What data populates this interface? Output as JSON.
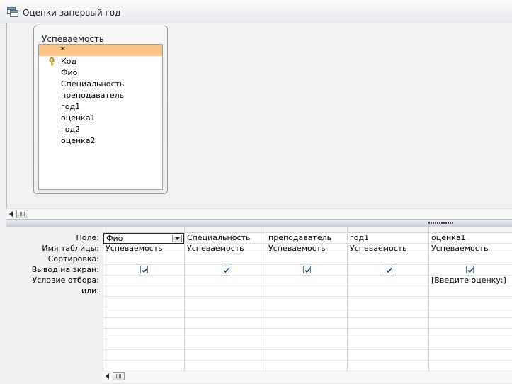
{
  "window": {
    "title": "Оценки запервый год"
  },
  "table_box": {
    "title": "Успеваемость",
    "fields": [
      "*",
      "Код",
      "Фио",
      "Специальность",
      "преподаватель",
      "год1",
      "оценка1",
      "год2",
      "оценка2"
    ],
    "selected_field": "*",
    "primary_key_field": "Код"
  },
  "grid": {
    "row_labels": [
      "Поле:",
      "Имя таблицы:",
      "Сортировка:",
      "Вывод на экран:",
      "Условие отбора:",
      "или:"
    ],
    "columns": [
      {
        "field": "Фио",
        "table": "Успеваемость",
        "sort": "",
        "show": true,
        "criteria": ""
      },
      {
        "field": "Специальность",
        "table": "Успеваемость",
        "sort": "",
        "show": true,
        "criteria": ""
      },
      {
        "field": "преподаватель",
        "table": "Успеваемость",
        "sort": "",
        "show": true,
        "criteria": ""
      },
      {
        "field": "год1",
        "table": "Успеваемость",
        "sort": "",
        "show": true,
        "criteria": ""
      },
      {
        "field": "оценка1",
        "table": "Успеваемость",
        "sort": "",
        "show": true,
        "criteria": "[Введите оценку:]"
      }
    ]
  },
  "colors": {
    "selected_row": "#fbc384",
    "accent": "#5a7ea8"
  },
  "icons": [
    "query-icon",
    "key-icon",
    "scroll-left-icon",
    "dropdown-arrow-icon",
    "checkbox-check-icon"
  ]
}
